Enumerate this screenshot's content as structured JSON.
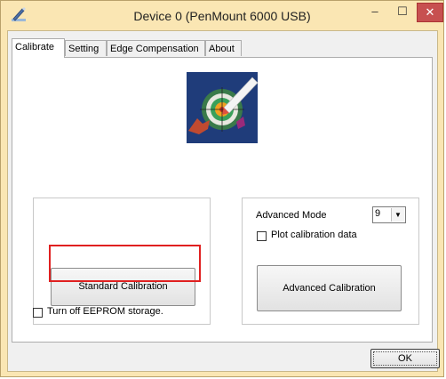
{
  "window": {
    "title": "Device 0 (PenMount 6000 USB)",
    "icon": "pen-icon",
    "minimize_glyph": "–",
    "maximize_glyph": "☐",
    "close_glyph": "✕"
  },
  "tabs": [
    {
      "label": "Calibrate",
      "active": true
    },
    {
      "label": "Setting",
      "active": false
    },
    {
      "label": "Edge Compensation",
      "active": false
    },
    {
      "label": "About",
      "active": false
    }
  ],
  "calibrate": {
    "standard_button_label": "Standard Calibration",
    "advanced_mode_label": "Advanced Mode",
    "advanced_mode_value": "9",
    "plot_label": "Plot calibration data",
    "plot_checked": false,
    "advanced_button_label": "Advanced Calibration",
    "eeprom_label": "Turn off EEPROM storage.",
    "eeprom_checked": false
  },
  "footer": {
    "ok_label": "OK"
  },
  "colors": {
    "title_bar": "#fae6b3",
    "close_button": "#c75050",
    "highlight": "#e02020"
  }
}
